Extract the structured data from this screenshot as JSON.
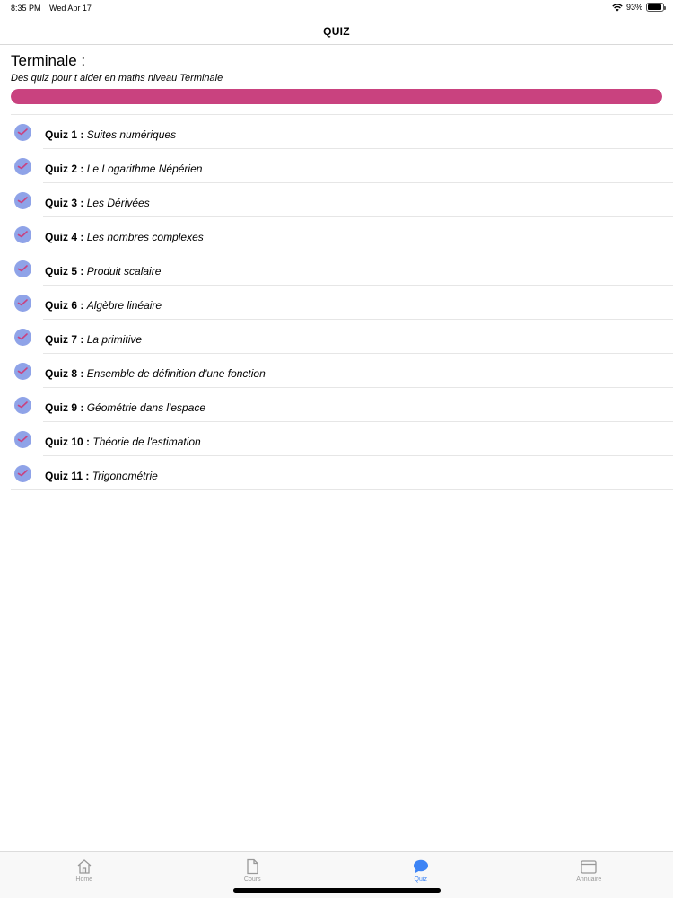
{
  "status_bar": {
    "time": "8:35 PM",
    "date": "Wed Apr 17",
    "battery": "93%",
    "battery_level": 0.93
  },
  "nav": {
    "title": "QUIZ"
  },
  "header": {
    "title": "Terminale :",
    "subtitle": "Des quiz pour t aider en maths niveau Terminale",
    "progress": 1.0,
    "progress_color": "#c9427f"
  },
  "quizzes": [
    {
      "number": "Quiz 1 :",
      "topic": "Suites numériques"
    },
    {
      "number": "Quiz 2 :",
      "topic": "Le Logarithme Népérien"
    },
    {
      "number": "Quiz 3 :",
      "topic": "Les Dérivées"
    },
    {
      "number": "Quiz 4 :",
      "topic": "Les nombres complexes"
    },
    {
      "number": "Quiz 5 :",
      "topic": "Produit scalaire"
    },
    {
      "number": "Quiz 6 :",
      "topic": "Algèbre linéaire"
    },
    {
      "number": "Quiz 7 :",
      "topic": "La primitive"
    },
    {
      "number": "Quiz 8 :",
      "topic": "Ensemble de définition d'une fonction"
    },
    {
      "number": "Quiz 9 :",
      "topic": "Géométrie dans l'espace"
    },
    {
      "number": "Quiz 10 :",
      "topic": "Théorie de l'estimation"
    },
    {
      "number": "Quiz 11 :",
      "topic": "Trigonométrie"
    }
  ],
  "quiz_icon": "check-badge-icon",
  "tabs": [
    {
      "label": "Home",
      "icon": "home-icon",
      "active": false
    },
    {
      "label": "Cours",
      "icon": "document-icon",
      "active": false
    },
    {
      "label": "Quiz",
      "icon": "chat-bubble-icon",
      "active": true
    },
    {
      "label": "Annuaire",
      "icon": "folder-icon",
      "active": false
    }
  ],
  "colors": {
    "accent": "#3d84f5",
    "inactive": "#999999",
    "icon_circle": "#8fa3e8",
    "icon_check": "#c9427f"
  }
}
